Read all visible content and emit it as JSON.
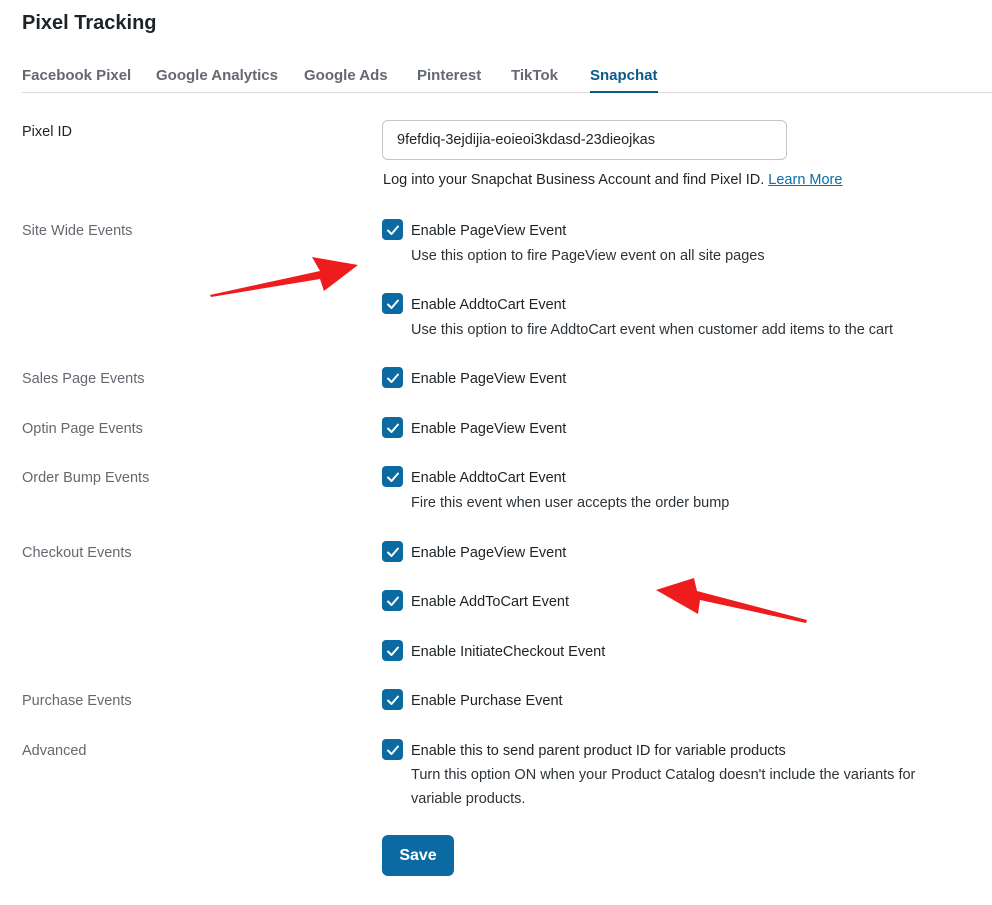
{
  "page_title": "Pixel Tracking",
  "tabs": [
    {
      "label": "Facebook Pixel",
      "active": false
    },
    {
      "label": "Google Analytics",
      "active": false
    },
    {
      "label": "Google Ads",
      "active": false
    },
    {
      "label": "Pinterest",
      "active": false
    },
    {
      "label": "TikTok",
      "active": false
    },
    {
      "label": "Snapchat",
      "active": true
    }
  ],
  "pixel_id": {
    "label": "Pixel ID",
    "value": "9fefdiq-3ejdijia-eoieoi3kdasd-23dieojkas",
    "help_text": "Log into your Snapchat Business Account and find Pixel ID.",
    "help_link": "Learn More"
  },
  "sections": {
    "site_wide": {
      "label": "Site Wide Events",
      "pageview_label": "Enable PageView Event",
      "pageview_desc": "Use this option to fire PageView event on all site pages",
      "addtocart_label": "Enable AddtoCart Event",
      "addtocart_desc": "Use this option to fire AddtoCart event when customer add items to the cart"
    },
    "sales_page": {
      "label": "Sales Page Events",
      "pageview_label": "Enable PageView Event"
    },
    "optin_page": {
      "label": "Optin Page Events",
      "pageview_label": "Enable PageView Event"
    },
    "order_bump": {
      "label": "Order Bump Events",
      "addtocart_label": "Enable AddtoCart Event",
      "addtocart_desc": "Fire this event when user accepts the order bump"
    },
    "checkout": {
      "label": "Checkout Events",
      "pageview_label": "Enable PageView Event",
      "addtocart_label": "Enable AddToCart Event",
      "initiate_label": "Enable InitiateCheckout Event"
    },
    "purchase": {
      "label": "Purchase Events",
      "purchase_label": "Enable Purchase Event"
    },
    "advanced": {
      "label": "Advanced",
      "parent_label": "Enable this to send parent product ID for variable products",
      "parent_desc_1": "Turn this option ON when your Product Catalog doesn't include the variants for",
      "parent_desc_2": "variable products."
    }
  },
  "checkboxes_checked": true,
  "save_label": "Save",
  "colors": {
    "accent": "#0a6aa1",
    "annotation_arrow": "#ee1c1c",
    "label_gray": "#646970"
  },
  "icons": [
    "checkmark-icon",
    "annotation-arrow"
  ]
}
